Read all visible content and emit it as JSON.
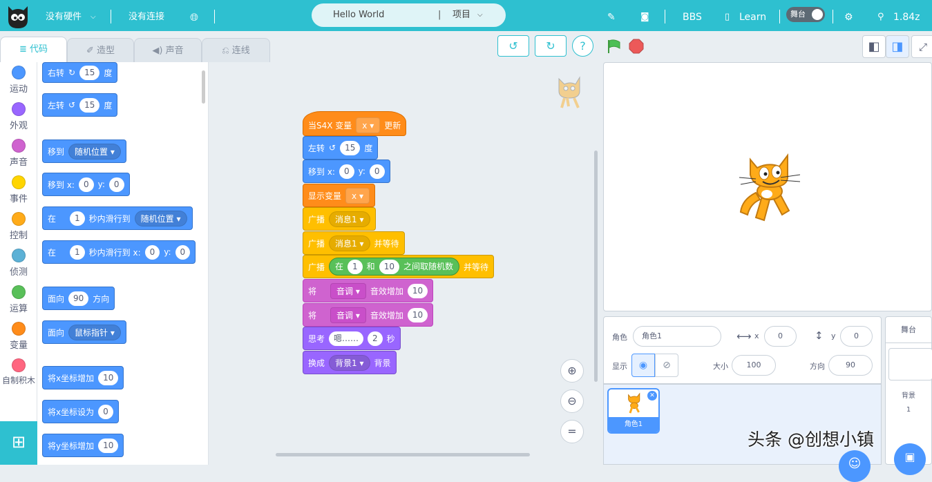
{
  "topbar": {
    "hardware": "没有硬件",
    "connection": "没有连接",
    "project_name": "Hello World",
    "project_menu": "项目",
    "bbs": "BBS",
    "learn": "Learn",
    "stage_toggle": "舞台",
    "version": "1.84z"
  },
  "tabs": {
    "code": "代码",
    "costumes": "造型",
    "sounds": "声音",
    "wiring": "连线"
  },
  "categories": [
    {
      "label": "运动",
      "color": "#4c97ff"
    },
    {
      "label": "外观",
      "color": "#9966ff"
    },
    {
      "label": "声音",
      "color": "#cf63cf"
    },
    {
      "label": "事件",
      "color": "#ffd500"
    },
    {
      "label": "控制",
      "color": "#ffab19"
    },
    {
      "label": "侦测",
      "color": "#5cb1d6"
    },
    {
      "label": "运算",
      "color": "#59c059"
    },
    {
      "label": "变量",
      "color": "#ff8c1a"
    },
    {
      "label": "自制积木",
      "color": "#ff6680"
    }
  ],
  "palette": {
    "turn_right": "右转",
    "turn_left": "左转",
    "deg": "度",
    "fifteen": "15",
    "goto": "移到",
    "random_pos": "随机位置",
    "goto_xy": "移到 x:",
    "y_label": "y:",
    "zero": "0",
    "glide_at": "在",
    "one": "1",
    "glide_to": "秒内滑行到",
    "glide_to_xy": "秒内滑行到 x:",
    "point_dir": "面向",
    "ninety": "90",
    "direction": "方向",
    "mouse_ptr": "鼠标指针",
    "change_x": "将x坐标增加",
    "ten": "10",
    "set_x": "将x坐标设为",
    "change_y": "将y坐标增加"
  },
  "script": {
    "hat_when": "当S4X 变量",
    "hat_var": "x",
    "hat_update": "更新",
    "turn_left": "左转",
    "turn_val": "15",
    "deg": "度",
    "goto": "移到 x:",
    "x_val": "0",
    "y_label": "y:",
    "y_val": "0",
    "show_var": "显示变量",
    "show_var_name": "x",
    "broadcast": "广播",
    "msg1": "消息1",
    "and_wait": "并等待",
    "b3_in": "在",
    "b3_a": "1",
    "b3_and": "和",
    "b3_b": "10",
    "b3_random": "之间取随机数",
    "effect_will": "将",
    "effect_pitch": "音调",
    "effect_change": "音效增加",
    "effect_val": "10",
    "think": "思考",
    "think_text": "嗯……",
    "think_secs": "2",
    "secs": "秒",
    "switch_bg": "换成",
    "backdrop": "背景1",
    "bg_word": "背景"
  },
  "sprite_info": {
    "sprite_label": "角色",
    "sprite_name": "角色1",
    "x_label": "x",
    "x_val": "0",
    "y_label": "y",
    "y_val": "0",
    "show_label": "显示",
    "size_label": "大小",
    "size_val": "100",
    "dir_label": "方向",
    "dir_val": "90"
  },
  "sprite_list": {
    "thumb_name": "角色1"
  },
  "stage_panel": {
    "title": "舞台",
    "bg_label": "背景",
    "bg_count": "1"
  },
  "watermark": "头条 @创想小镇"
}
